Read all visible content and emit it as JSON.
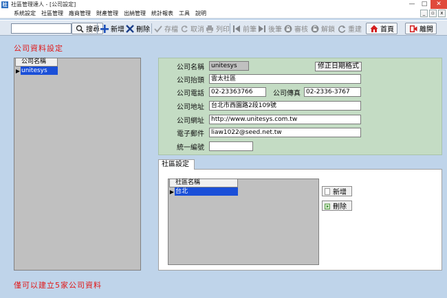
{
  "window": {
    "title": "社區管理達人 - [公司設定]",
    "app_icon_text": "社",
    "controls": [
      "—",
      "□",
      "✕"
    ]
  },
  "menu": {
    "items": [
      "系統設定",
      "社區管理",
      "廠商管理",
      "財產管理",
      "出納管理",
      "統計報表",
      "工具",
      "說明"
    ]
  },
  "toolbar": {
    "search_value": "",
    "search": "搜尋",
    "add": "新增",
    "delete": "刪除",
    "save": "存檔",
    "cancel": "取消",
    "print": "列印",
    "prev": "前筆",
    "next": "後筆",
    "review": "審核",
    "unlock": "解鎖",
    "rebuild": "重建",
    "home": "首頁",
    "exit": "離開"
  },
  "page": {
    "heading": "公司資料設定",
    "footnote": "僅可以建立5家公司資料"
  },
  "company_grid": {
    "header": "公司名稱",
    "rows": [
      "unitesys"
    ]
  },
  "form": {
    "fix_date_format": "修正日期格式",
    "name_label": "公司名稱",
    "name_value": "unitesys",
    "letterhead_label": "公司抬頭",
    "letterhead_value": "雲太社區",
    "phone_label": "公司電話",
    "phone_value": "02-23363766",
    "fax_label": "公司傳真",
    "fax_value": "02-2336-3767",
    "address_label": "公司地址",
    "address_value": "台北市西園路2段109號",
    "website_label": "公司網址",
    "website_value": "http://www.unitesys.com.tw",
    "email_label": "電子郵件",
    "email_value": "liaw1022@seed.net.tw",
    "tax_id_label": "統一編號",
    "tax_id_value": ""
  },
  "community": {
    "tab": "社區設定",
    "grid_header": "社區名稱",
    "rows": [
      "台北"
    ],
    "add": "新增",
    "delete": "刪除"
  },
  "colors": {
    "accent_red": "#e01818",
    "selection_blue": "#1a4fd8",
    "form_green": "#c4dcc4",
    "background": "#bfd4ea"
  }
}
